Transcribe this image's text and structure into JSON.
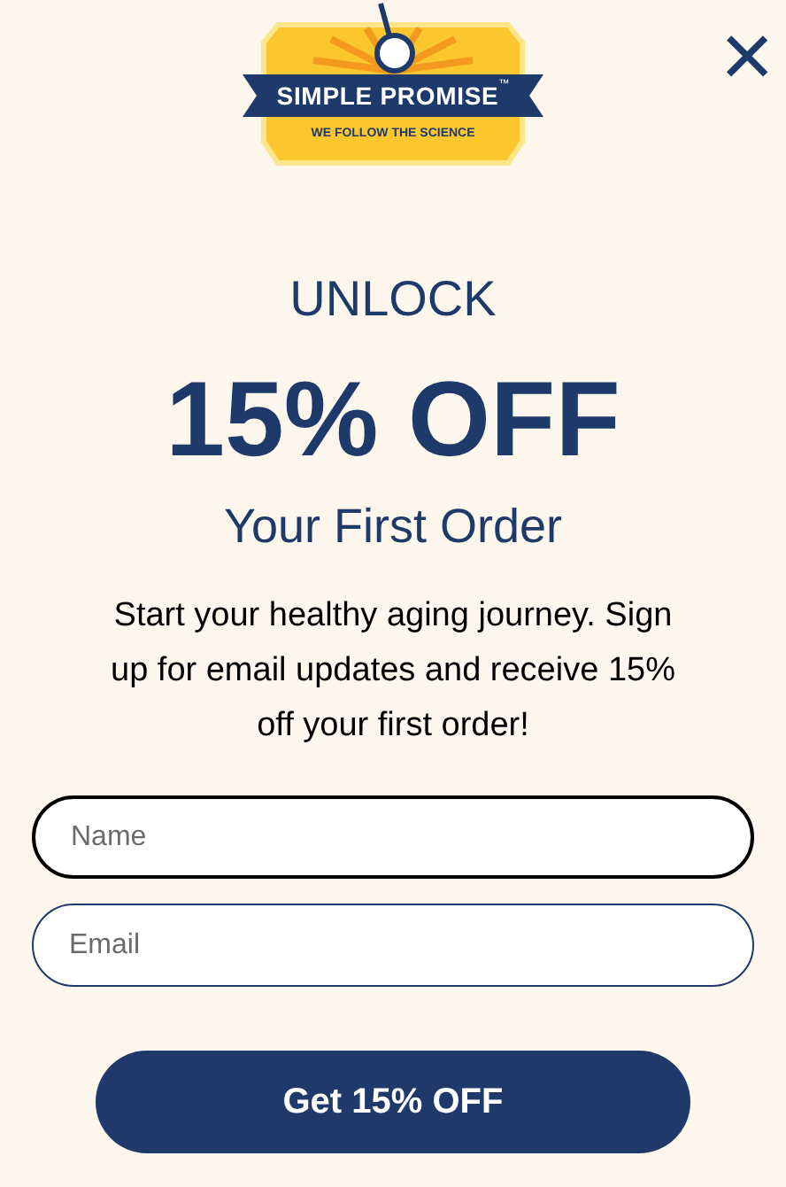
{
  "logo": {
    "brand": "SIMPLE PROMISE",
    "trademark": "™",
    "tagline": "WE FOLLOW THE SCIENCE"
  },
  "close": {
    "label": "×"
  },
  "headline": {
    "kicker": "UNLOCK",
    "offer": "15% OFF",
    "subtitle": "Your First Order"
  },
  "body": "Start your healthy aging journey. Sign up for email updates and receive 15% off your first order!",
  "fields": [
    {
      "placeholder": "Name",
      "focused": true
    },
    {
      "placeholder": "Email",
      "focused": false
    }
  ],
  "submit": {
    "label": "Get 15% OFF"
  }
}
